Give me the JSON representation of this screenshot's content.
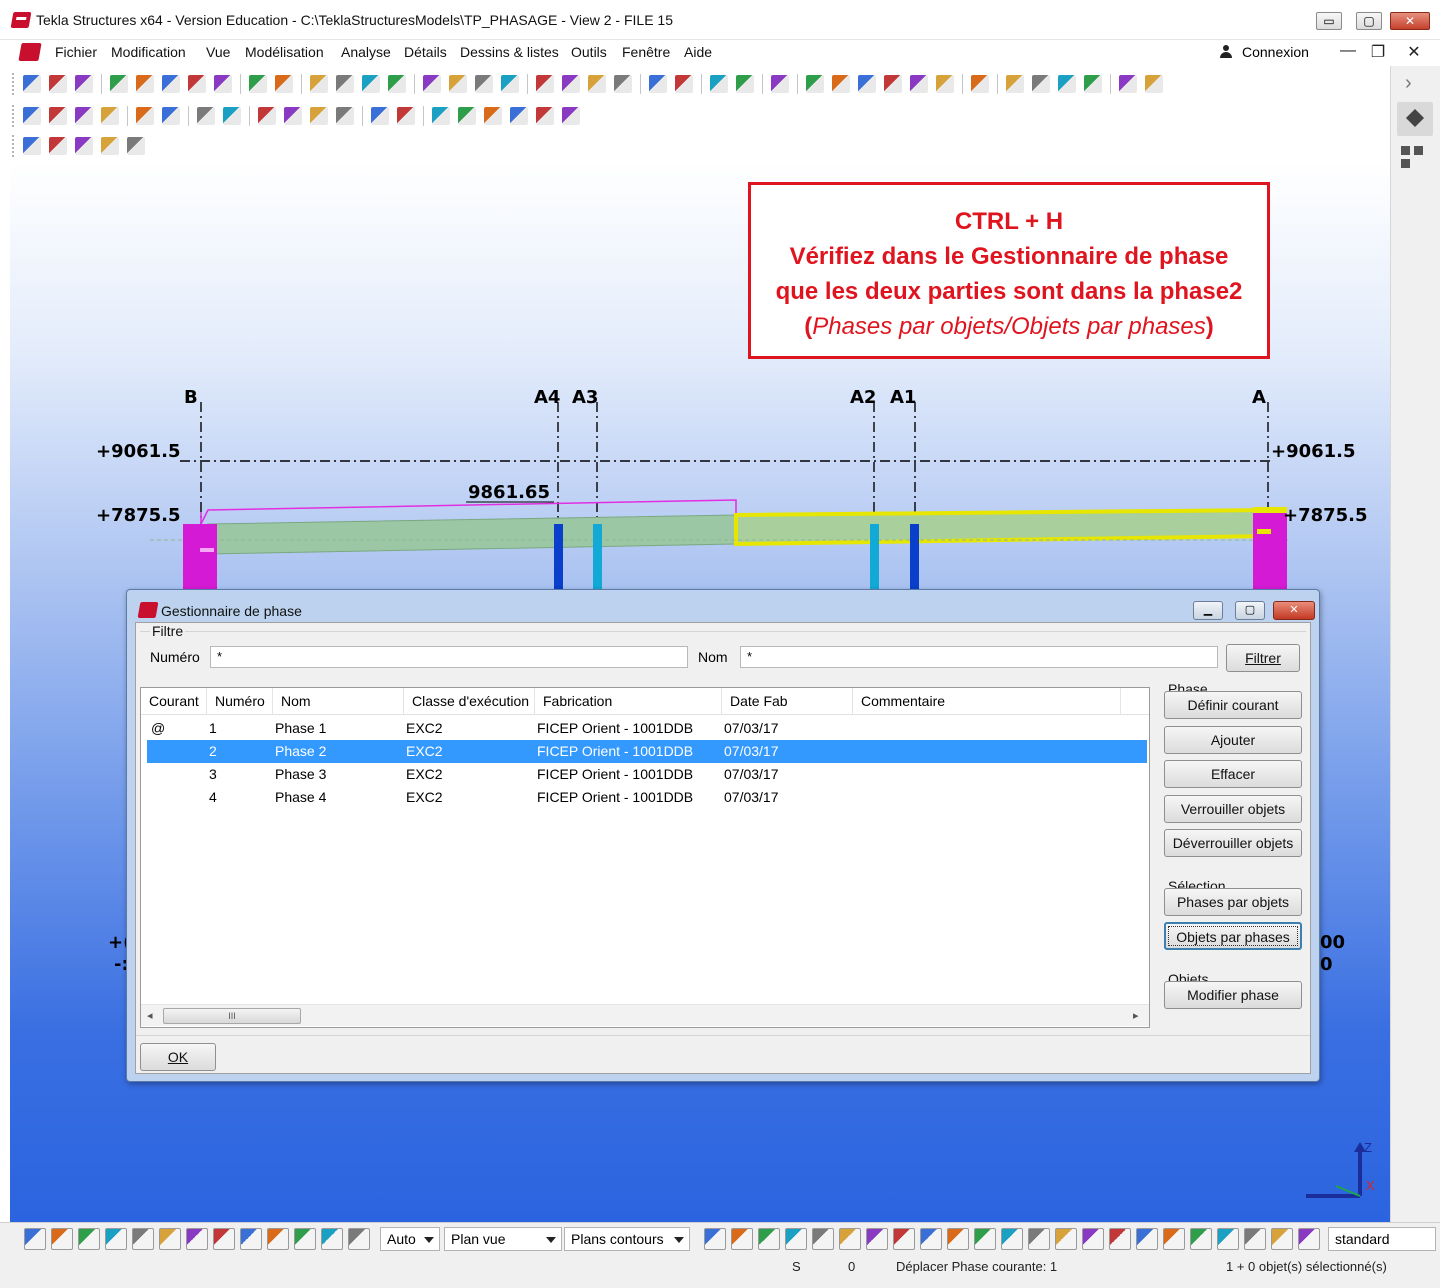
{
  "window": {
    "title": "Tekla Structures x64 - Version Education - C:\\TeklaStructuresModels\\TP_PHASAGE  - View 2 - FILE 15",
    "buttons": {
      "minimize": "▭",
      "maximize": "▢",
      "close": "✕"
    }
  },
  "menubar": {
    "items": [
      "Fichier",
      "Modification",
      "Vue",
      "Modélisation",
      "Analyse",
      "Détails",
      "Dessins & listes",
      "Outils",
      "Fenêtre",
      "Aide"
    ],
    "connexion": "Connexion",
    "mdi": {
      "minimize": "—",
      "restore": "❐",
      "close": "✕"
    }
  },
  "sidepanel": {
    "expand": "›"
  },
  "viewport": {
    "grid_labels": {
      "b": "B",
      "a4": "A4",
      "a3": "A3",
      "a2": "A2",
      "a1": "A1",
      "a": "A",
      "elev_left_top": "+9061.5",
      "elev_left_mid": "+7875.5",
      "elev_right_top": "+9061.5",
      "elev_right_mid": "+7875.5",
      "dimension": "9861.65",
      "left_partial_1": "+(",
      "left_partial_2": "-:",
      "right_partial_1": "00",
      "right_partial_2": "0"
    },
    "note": {
      "line1": "CTRL + H",
      "line2": "Vérifiez dans le Gestionnaire de phase",
      "line3": "que les deux parties sont dans la phase2",
      "line4_open": "(",
      "line4_italic": "Phases par objets/Objets par phases",
      "line4_close": ")"
    },
    "axis": {
      "z": "Z",
      "x": "X"
    },
    "colors": {
      "column": "#d41ad4",
      "beam": "#9cc7a4",
      "highlight": "#e6e600",
      "post_dark": "#0a3fcc",
      "post_light": "#12a9d6"
    }
  },
  "dialog": {
    "title": "Gestionnaire de phase",
    "filtre_group": "Filtre",
    "numero_label": "Numéro",
    "numero_value": "*",
    "nom_label": "Nom",
    "nom_value": "*",
    "filtrer_button": "Filtrer",
    "columns": [
      "Courant",
      "Numéro",
      "Nom",
      "Classe d'exécution",
      "Fabrication",
      "Date Fab",
      "Commentaire"
    ],
    "rows": [
      {
        "courant": "@",
        "numero": "1",
        "nom": "Phase 1",
        "classe": "EXC2",
        "fabrication": "FICEP Orient - 1001DDB",
        "date": "07/03/17",
        "commentaire": ""
      },
      {
        "courant": "",
        "numero": "2",
        "nom": "Phase 2",
        "classe": "EXC2",
        "fabrication": "FICEP Orient - 1001DDB",
        "date": "07/03/17",
        "commentaire": ""
      },
      {
        "courant": "",
        "numero": "3",
        "nom": "Phase 3",
        "classe": "EXC2",
        "fabrication": "FICEP Orient - 1001DDB",
        "date": "07/03/17",
        "commentaire": ""
      },
      {
        "courant": "",
        "numero": "4",
        "nom": "Phase 4",
        "classe": "EXC2",
        "fabrication": "FICEP Orient - 1001DDB",
        "date": "07/03/17",
        "commentaire": ""
      }
    ],
    "selected_row": 1,
    "scroll_thumb": "III",
    "phase_group": "Phase",
    "definir_courant": "Définir courant",
    "ajouter": "Ajouter",
    "effacer": "Effacer",
    "verrouiller": "Verrouiller objets",
    "deverrouiller": "Déverrouiller objets",
    "selection_group": "Sélection",
    "phases_par_objets": "Phases par objets",
    "objets_par_phases": "Objets par phases",
    "objets_group": "Objets",
    "modifier_phase": "Modifier phase",
    "ok": "OK"
  },
  "bottombar": {
    "auto": "Auto",
    "plan_vue": "Plan vue",
    "plans_contours": "Plans contours",
    "standard": "standard"
  },
  "statusbar": {
    "s": "S",
    "zero": "0",
    "message": "Déplacer Phase courante: 1",
    "selection": "1 + 0 objet(s) sélectionné(s)"
  }
}
